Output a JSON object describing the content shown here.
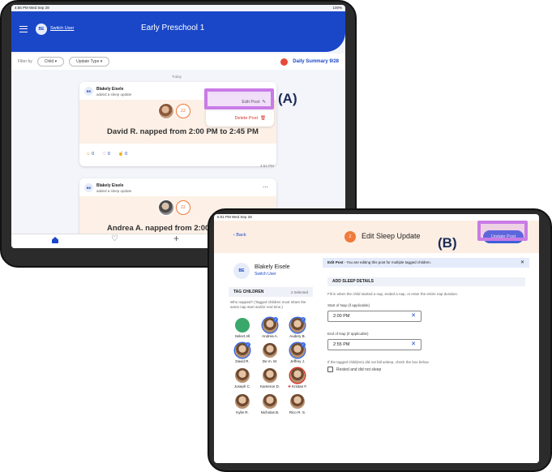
{
  "callouts": {
    "a": "(A)",
    "b": "(B)"
  },
  "screen_a": {
    "status_left": "4:56 PM  Wed Sep 28",
    "status_right": "100%",
    "header": {
      "avatar_initials": "BE",
      "switch_user": "Switch User",
      "title": "Early Preschool 1"
    },
    "filter": {
      "label": "Filter by",
      "child": "Child",
      "update_type": "Update Type",
      "daily_summary": "Daily Summary 9/28"
    },
    "section_label": "Today",
    "post1": {
      "author": "Blakely Eisele",
      "action": "added a sleep update",
      "menu_edit": "Edit Post",
      "menu_delete": "Delete Post",
      "message": "David R. napped from 2:00 PM to 2:45 PM",
      "reactions": [
        "0",
        "0",
        "0"
      ],
      "time": "4:54 PM"
    },
    "post2": {
      "author": "Blakely Eisele",
      "action": "added a sleep update",
      "more": "...",
      "message": "Andrea A. napped from 2:00 PM"
    },
    "nav": {
      "plus": "+"
    }
  },
  "screen_b": {
    "status_left": "5:01 PM  Wed Sep 28",
    "back": "Back",
    "title": "Edit Sleep Update",
    "update_post": "Update Post",
    "user": {
      "initials": "BE",
      "name": "Blakely Eisele",
      "switch": "Switch User"
    },
    "tag_children": "TAG CHILDREN",
    "selected": "4 Selected",
    "tag_help": "Who napped? (Tagged children must share the same nap start and/or end time.)",
    "children": [
      {
        "name": "Select All",
        "checked": false,
        "select_all": true
      },
      {
        "name": "Andrea A.",
        "checked": true
      },
      {
        "name": "Audery B.",
        "checked": true
      },
      {
        "name": "David R.",
        "checked": true
      },
      {
        "name": "De m. M.",
        "checked": false
      },
      {
        "name": "Jeffrey J.",
        "checked": true
      },
      {
        "name": "Joseph C.",
        "checked": false
      },
      {
        "name": "Kameron D.",
        "checked": false
      },
      {
        "name": "Kristan F.",
        "checked": false,
        "alert": true
      },
      {
        "name": "Kylie R.",
        "checked": false
      },
      {
        "name": "Nicholas B.",
        "checked": false
      },
      {
        "name": "Rico R. S.",
        "checked": false
      }
    ],
    "banner_bold": "Edit Post",
    "banner_text": " - You are editing this post for multiple tagged children.",
    "banner_close": "✕",
    "section_title": "ADD SLEEP DETAILS",
    "help": "Fill in when the child started a nap, ended a nap, or enter the entire nap duration.",
    "start_label": "Start of Nap (if applicable)",
    "start_value": "2:00 PM",
    "end_label": "End of Nap (if applicable)",
    "end_value": "2:55 PM",
    "clear": "✕",
    "rested_help": "If the tagged child(ren) did not fall asleep, check the box below.",
    "rested_label": "Rested and did not sleep"
  }
}
